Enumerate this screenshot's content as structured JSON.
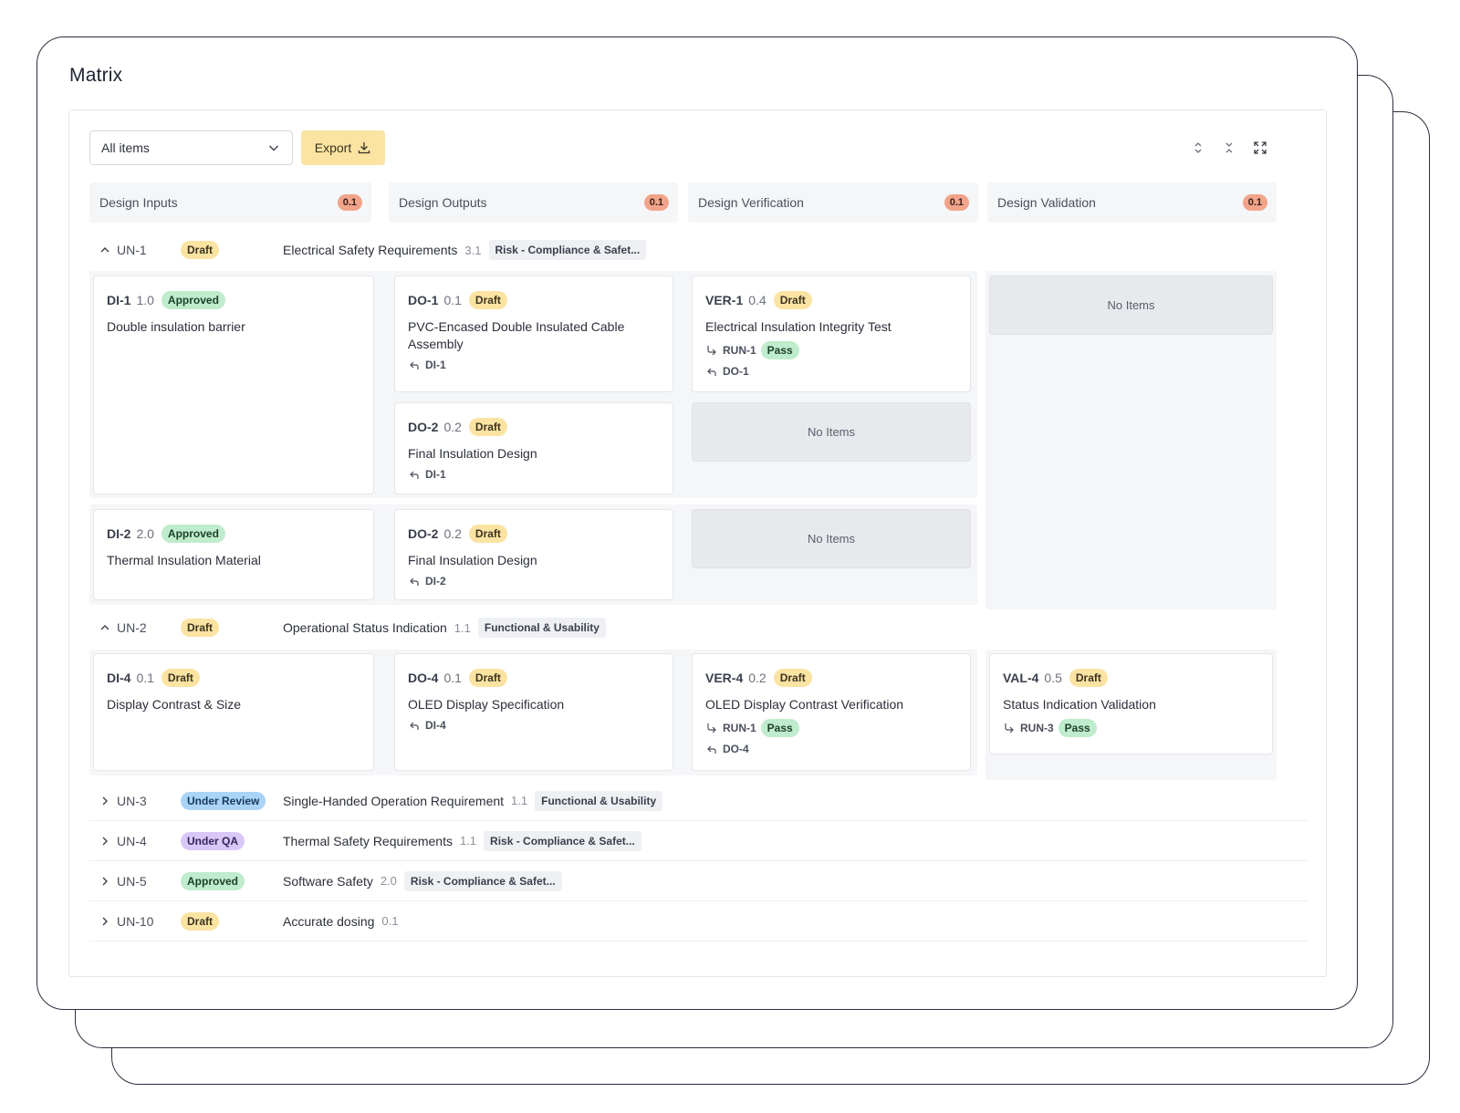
{
  "window": {
    "title": "Matrix"
  },
  "toolbar": {
    "filter_value": "All items",
    "export_label": "Export"
  },
  "columns": [
    {
      "label": "Design Inputs",
      "count": "0.1"
    },
    {
      "label": "Design Outputs",
      "count": "0.1"
    },
    {
      "label": "Design Verification",
      "count": "0.1"
    },
    {
      "label": "Design Validation",
      "count": "0.1"
    }
  ],
  "empty_label": "No Items",
  "groups": [
    {
      "id": "UN-1",
      "status": "Draft",
      "title": "Electrical Safety Requirements",
      "version": "3.1",
      "tag": "Risk - Compliance & Safet..."
    },
    {
      "id": "UN-2",
      "status": "Draft",
      "title": "Operational Status Indication",
      "version": "1.1",
      "tag": "Functional & Usability"
    },
    {
      "id": "UN-3",
      "status": "Under Review",
      "title": "Single-Handed Operation Requirement",
      "version": "1.1",
      "tag": "Functional & Usability"
    },
    {
      "id": "UN-4",
      "status": "Under QA",
      "title": "Thermal Safety Requirements",
      "version": "1.1",
      "tag": "Risk - Compliance & Safet..."
    },
    {
      "id": "UN-5",
      "status": "Approved",
      "title": "Software Safety",
      "version": "2.0",
      "tag": "Risk - Compliance & Safet..."
    },
    {
      "id": "UN-10",
      "status": "Draft",
      "title": "Accurate dosing",
      "version": "0.1"
    }
  ],
  "cards": {
    "di1": {
      "id": "DI-1",
      "version": "1.0",
      "status": "Approved",
      "title": "Double insulation barrier"
    },
    "do1": {
      "id": "DO-1",
      "version": "0.1",
      "status": "Draft",
      "title": "PVC-Encased Double Insulated Cable Assembly",
      "link": "DI-1"
    },
    "ver1": {
      "id": "VER-1",
      "version": "0.4",
      "status": "Draft",
      "title": "Electrical Insulation Integrity Test",
      "run": "RUN-1",
      "run_status": "Pass",
      "link": "DO-1"
    },
    "do2a": {
      "id": "DO-2",
      "version": "0.2",
      "status": "Draft",
      "title": "Final Insulation Design",
      "link": "DI-1"
    },
    "di2": {
      "id": "DI-2",
      "version": "2.0",
      "status": "Approved",
      "title": "Thermal Insulation Material"
    },
    "do2b": {
      "id": "DO-2",
      "version": "0.2",
      "status": "Draft",
      "title": "Final Insulation Design",
      "link": "DI-2"
    },
    "di4": {
      "id": "DI-4",
      "version": "0.1",
      "status": "Draft",
      "title": "Display Contrast & Size"
    },
    "do4": {
      "id": "DO-4",
      "version": "0.1",
      "status": "Draft",
      "title": "OLED Display Specification",
      "link": "DI-4"
    },
    "ver4": {
      "id": "VER-4",
      "version": "0.2",
      "status": "Draft",
      "title": "OLED Display Contrast Verification",
      "run": "RUN-1",
      "run_status": "Pass",
      "link": "DO-4"
    },
    "val4": {
      "id": "VAL-4",
      "version": "0.5",
      "status": "Draft",
      "title": "Status Indication Validation",
      "run": "RUN-3",
      "run_status": "Pass"
    }
  }
}
